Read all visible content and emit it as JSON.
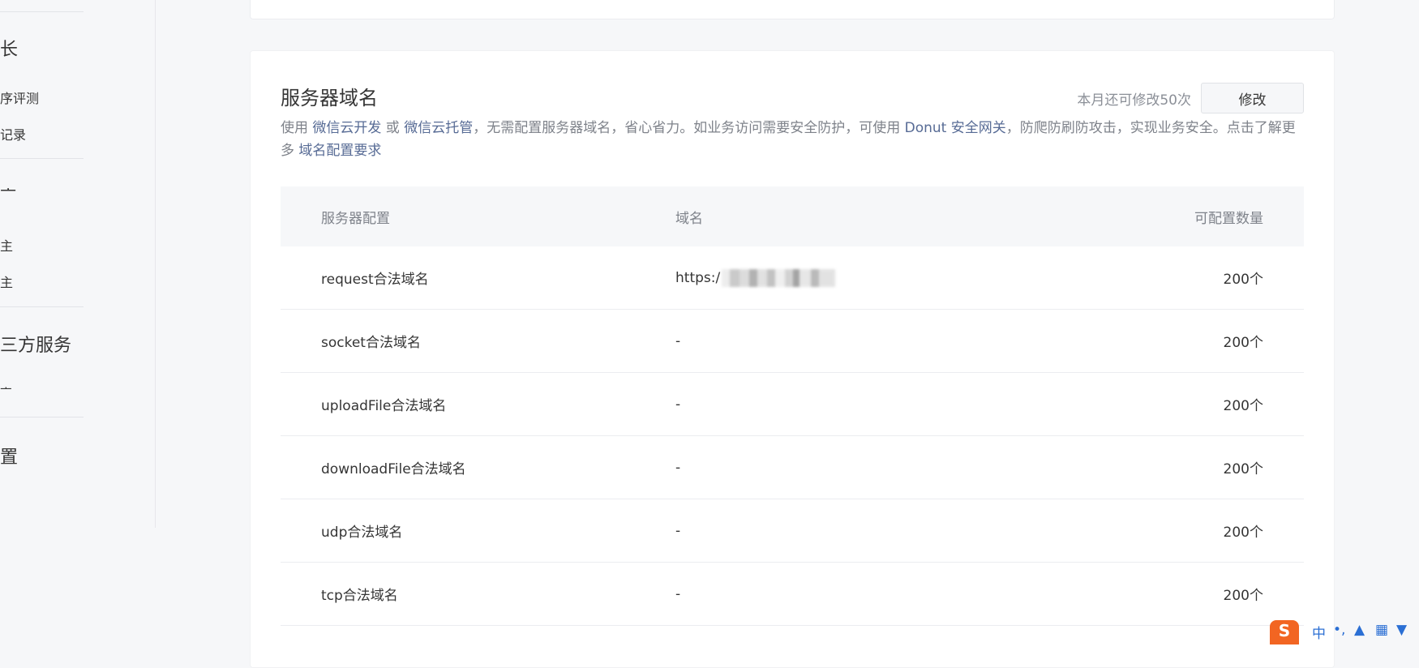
{
  "sidebar": {
    "sections": [
      {
        "label": "长"
      },
      {
        "label": "ᅩ"
      },
      {
        "label": "三方服务"
      },
      {
        "label": "置"
      }
    ],
    "items": [
      {
        "label": "序评测"
      },
      {
        "label": "记录"
      },
      {
        "label": "主"
      },
      {
        "label": "主"
      },
      {
        "label": "ᅩ"
      }
    ]
  },
  "server_domain": {
    "title": "服务器域名",
    "remaining": "本月还可修改50次",
    "modify_label": "修改",
    "desc": {
      "t1": "使用 ",
      "l1": "微信云开发",
      "t2": " 或 ",
      "l2": "微信云托管",
      "t3": "，无需配置服务器域名，省心省力。如业务访问需要安全防护，可使用 ",
      "l3": "Donut 安全网关",
      "t4": "，防爬防刷防攻击，实现业务安全。点击了解更多 ",
      "l4": "域名配置要求"
    },
    "columns": [
      "服务器配置",
      "域名",
      "可配置数量"
    ],
    "rows": [
      {
        "config": "request合法域名",
        "domain": "https:/",
        "count": "200个"
      },
      {
        "config": "socket合法域名",
        "domain": "-",
        "count": "200个"
      },
      {
        "config": "uploadFile合法域名",
        "domain": "-",
        "count": "200个"
      },
      {
        "config": "downloadFile合法域名",
        "domain": "-",
        "count": "200个"
      },
      {
        "config": "udp合法域名",
        "domain": "-",
        "count": "200个"
      },
      {
        "config": "tcp合法域名",
        "domain": "-",
        "count": "200个"
      }
    ]
  },
  "tray": {
    "logo": "S",
    "ime_lang": "中"
  }
}
